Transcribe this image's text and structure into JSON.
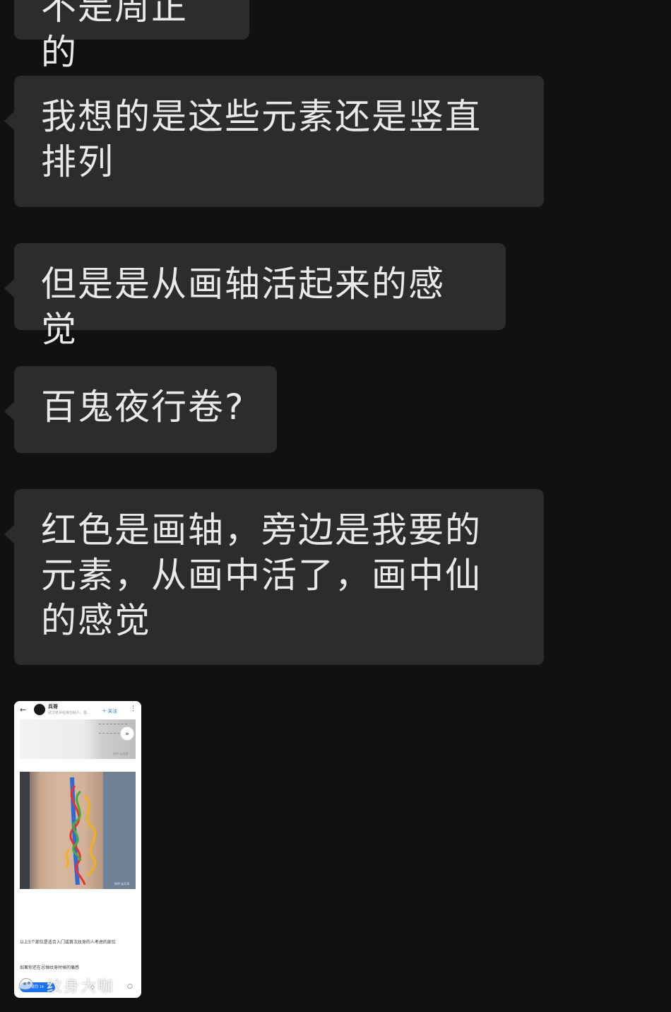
{
  "chat": {
    "messages": [
      {
        "text": "不是周正的"
      },
      {
        "text": "我想的是这些元素还是竖直排列"
      },
      {
        "text": "但是是从画轴活起来的感觉"
      },
      {
        "text": "百鬼夜行卷?"
      },
      {
        "text": "红色是画轴，旁边是我要的元素，从画中活了，画中仙的感觉"
      }
    ]
  },
  "thumbnail": {
    "author": "兵哥",
    "subtitle": "武汉老兵纹身创始人，首...",
    "follow": "＋ 关注",
    "caption1": "知乎 @兵哥",
    "caption2": "知乎 @兵哥",
    "text1": "以上5个部位是适合入门或首次纹身的人考虑的部位",
    "text2": "如果你还在忌惮纹身时候的痛感",
    "pill": "赞同 14",
    "watermark": "纹身大咖",
    "icons": {
      "back": "back-arrow-icon",
      "more": "more-vertical-icon",
      "collapse": "chevron-double-down-icon",
      "comment": "comment-icon",
      "star": "star-icon"
    },
    "colors": {
      "follow": "#1772f6",
      "red_line": "#e8332a",
      "green_line": "#3fae3a",
      "yellow_line": "#f2b216",
      "blue_line": "#2f6ad9"
    }
  }
}
